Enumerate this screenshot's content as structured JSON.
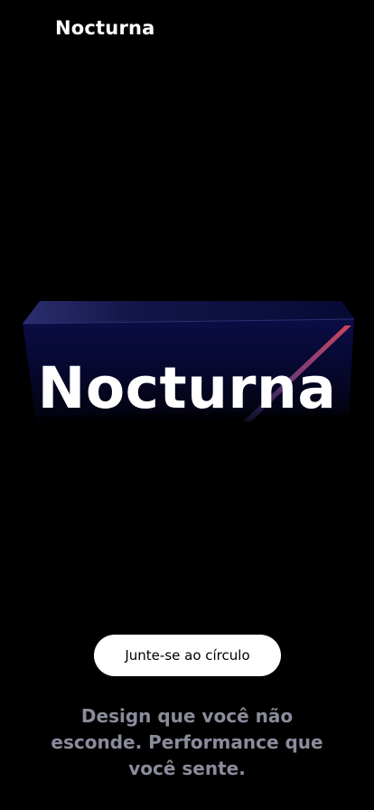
{
  "header": {
    "brand": "Nocturna"
  },
  "hero": {
    "title": "Nocturna"
  },
  "cta": {
    "label": "Junte-se ao círculo"
  },
  "tagline": {
    "text": "Design que você não esconde. Performance que você sente."
  },
  "colors": {
    "background": "#000000",
    "hero_panel": "#0a0c3a",
    "accent_stripe": "#c2465a",
    "tagline": "#8a8b9b",
    "button_bg": "#ffffff",
    "button_text": "#000000"
  }
}
